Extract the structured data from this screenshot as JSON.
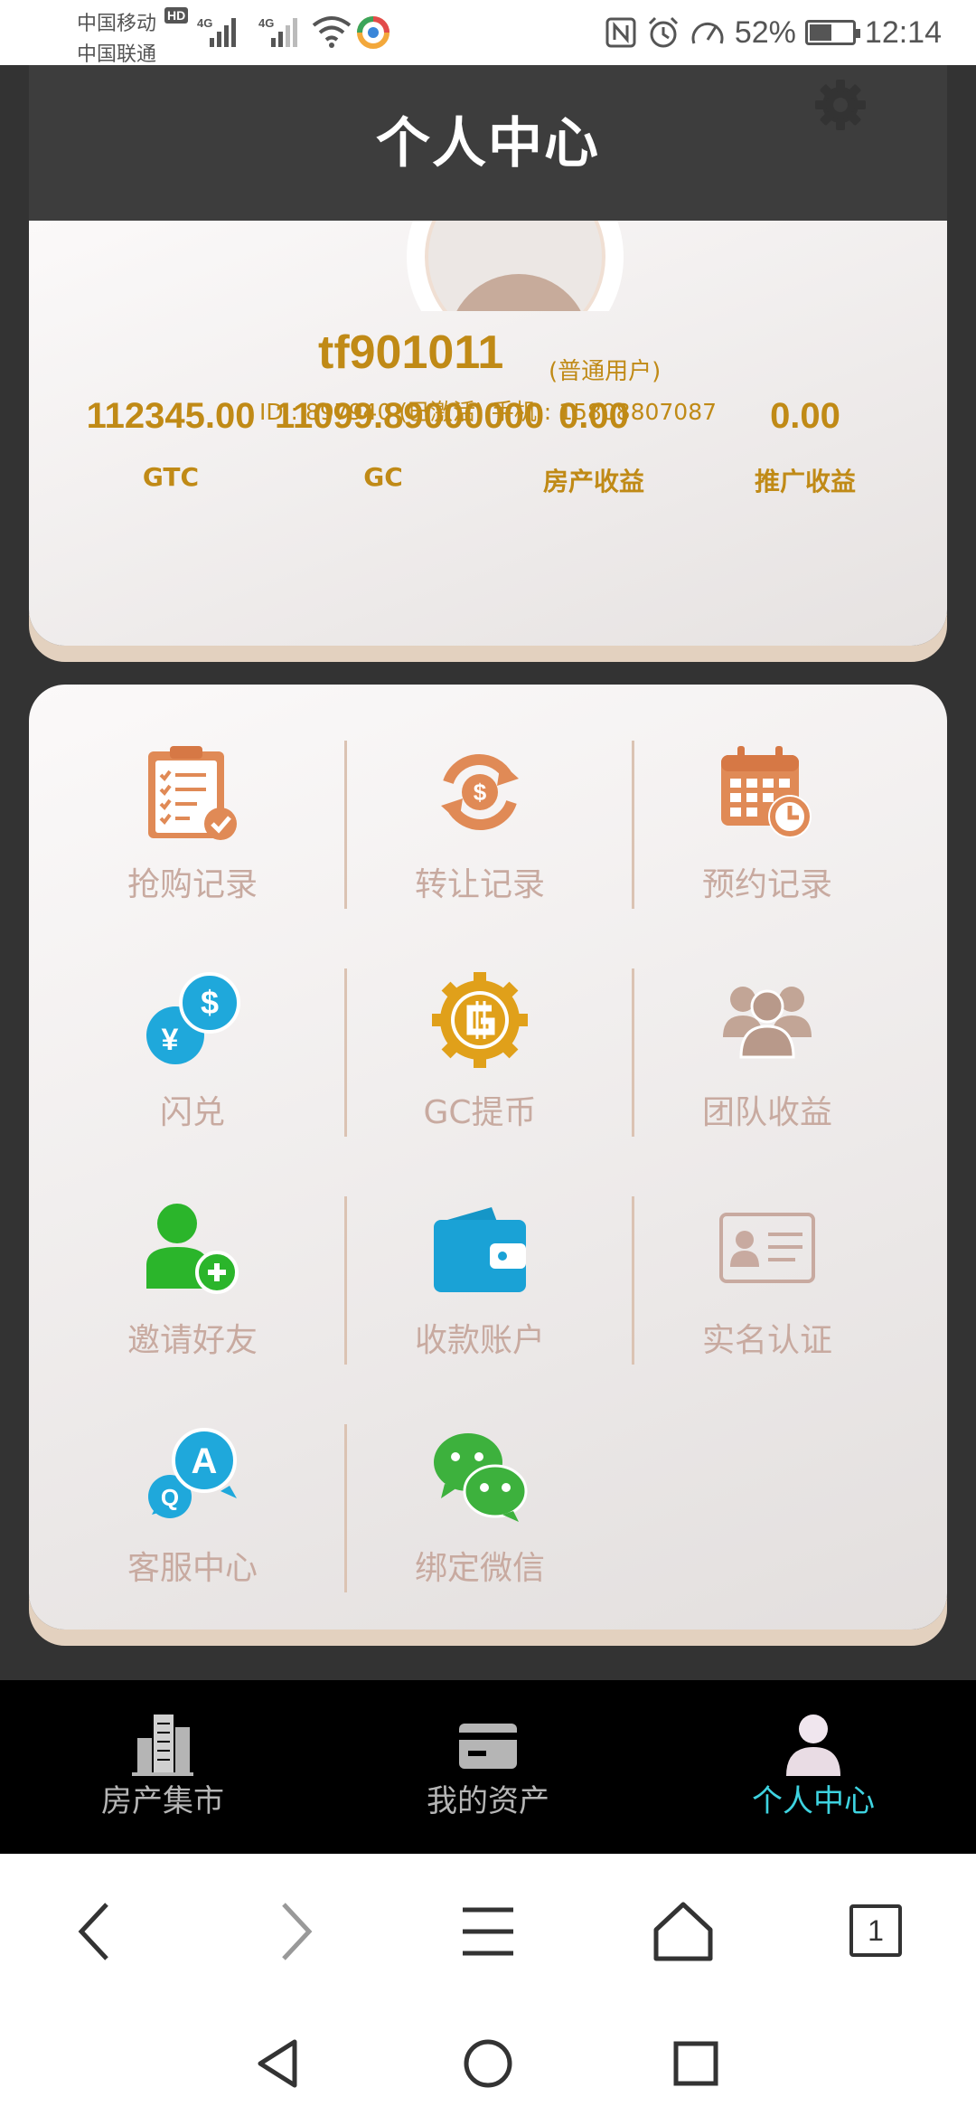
{
  "status_bar": {
    "carrier_1": "中国移动",
    "carrier_2": "中国联通",
    "hd_badge": "HD",
    "network_1": "4G",
    "network_2": "4G",
    "battery_percent": "52%",
    "battery_level": 0.52,
    "time": "12:14"
  },
  "header": {
    "title": "个人中心",
    "settings_icon": "gear-icon"
  },
  "profile": {
    "username": "tf901011",
    "role": "(普通用户)",
    "info": "ID : 897940 (已激活) 手机 : 15808807087",
    "stats": [
      {
        "value": "112345.00",
        "label": "GTC"
      },
      {
        "value": "11099.89000000",
        "label": "GC"
      },
      {
        "value": "0.00",
        "label": "房产收益"
      },
      {
        "value": "0.00",
        "label": "推广收益"
      }
    ]
  },
  "menu": {
    "items": [
      {
        "label": "抢购记录",
        "icon": "clipboard-check-icon"
      },
      {
        "label": "转让记录",
        "icon": "dollar-exchange-icon"
      },
      {
        "label": "预约记录",
        "icon": "calendar-clock-icon"
      },
      {
        "label": "闪兑",
        "icon": "currency-swap-icon"
      },
      {
        "label": "GC提币",
        "icon": "gc-coin-icon"
      },
      {
        "label": "团队收益",
        "icon": "team-icon"
      },
      {
        "label": "邀请好友",
        "icon": "add-user-icon"
      },
      {
        "label": "收款账户",
        "icon": "wallet-icon"
      },
      {
        "label": "实名认证",
        "icon": "id-card-icon"
      },
      {
        "label": "客服中心",
        "icon": "qa-chat-icon"
      },
      {
        "label": "绑定微信",
        "icon": "wechat-icon"
      }
    ]
  },
  "tab_bar": {
    "items": [
      {
        "label": "房产集市",
        "icon": "buildings-icon"
      },
      {
        "label": "我的资产",
        "icon": "card-icon"
      },
      {
        "label": "个人中心",
        "icon": "user-icon",
        "active": true
      }
    ]
  },
  "browser_bar": {
    "tab_count": "1"
  },
  "colors": {
    "accent_gold": "#c08a16",
    "menu_label": "#c8aaa0",
    "active_tab": "#3ed3e0",
    "header_bg": "#3d3d3d"
  }
}
